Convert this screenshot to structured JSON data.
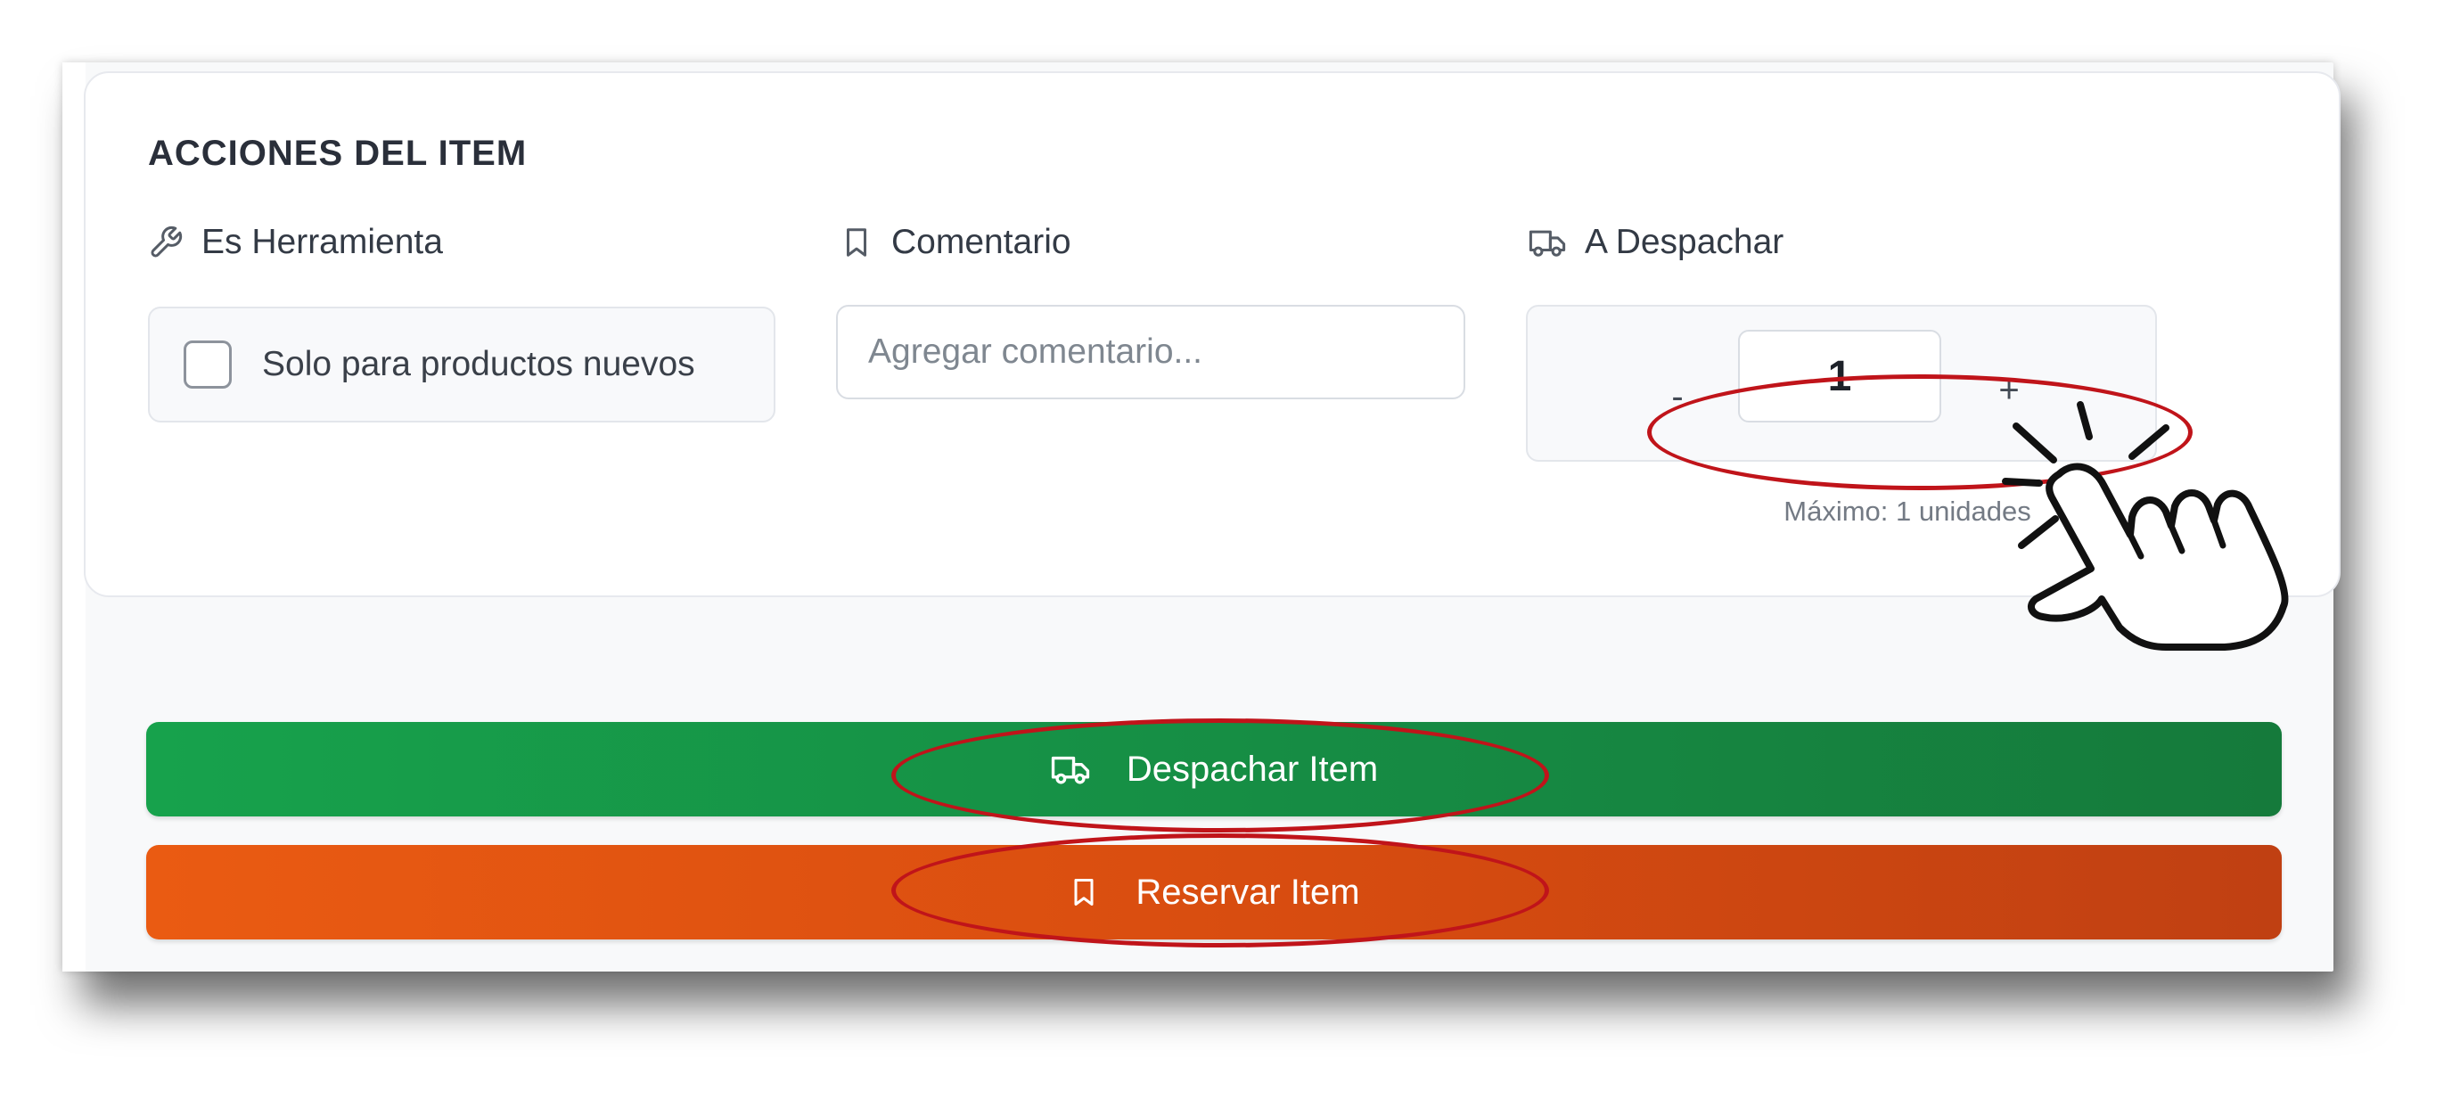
{
  "card": {
    "title": "ACCIONES DEL ITEM"
  },
  "fields": {
    "tool": {
      "label": "Es Herramienta",
      "icon": "wrench-icon",
      "checkbox_label": "Solo para productos nuevos",
      "checked": false
    },
    "comment": {
      "label": "Comentario",
      "icon": "bookmark-icon",
      "placeholder": "Agregar comentario...",
      "value": ""
    },
    "dispatch": {
      "label": "A Despachar",
      "icon": "truck-icon",
      "minus_label": "-",
      "plus_label": "+",
      "quantity": "1",
      "max_hint": "Máximo: 1 unidades"
    }
  },
  "actions": {
    "despachar": {
      "label": "Despachar Item",
      "icon": "truck-icon",
      "color": "#17a24c"
    },
    "reservar": {
      "label": "Reservar Item",
      "icon": "bookmark-icon",
      "color": "#ea5b12"
    }
  },
  "annotations": {
    "color": "#c0141a",
    "pointer_icon": "pointing-hand-icon"
  }
}
